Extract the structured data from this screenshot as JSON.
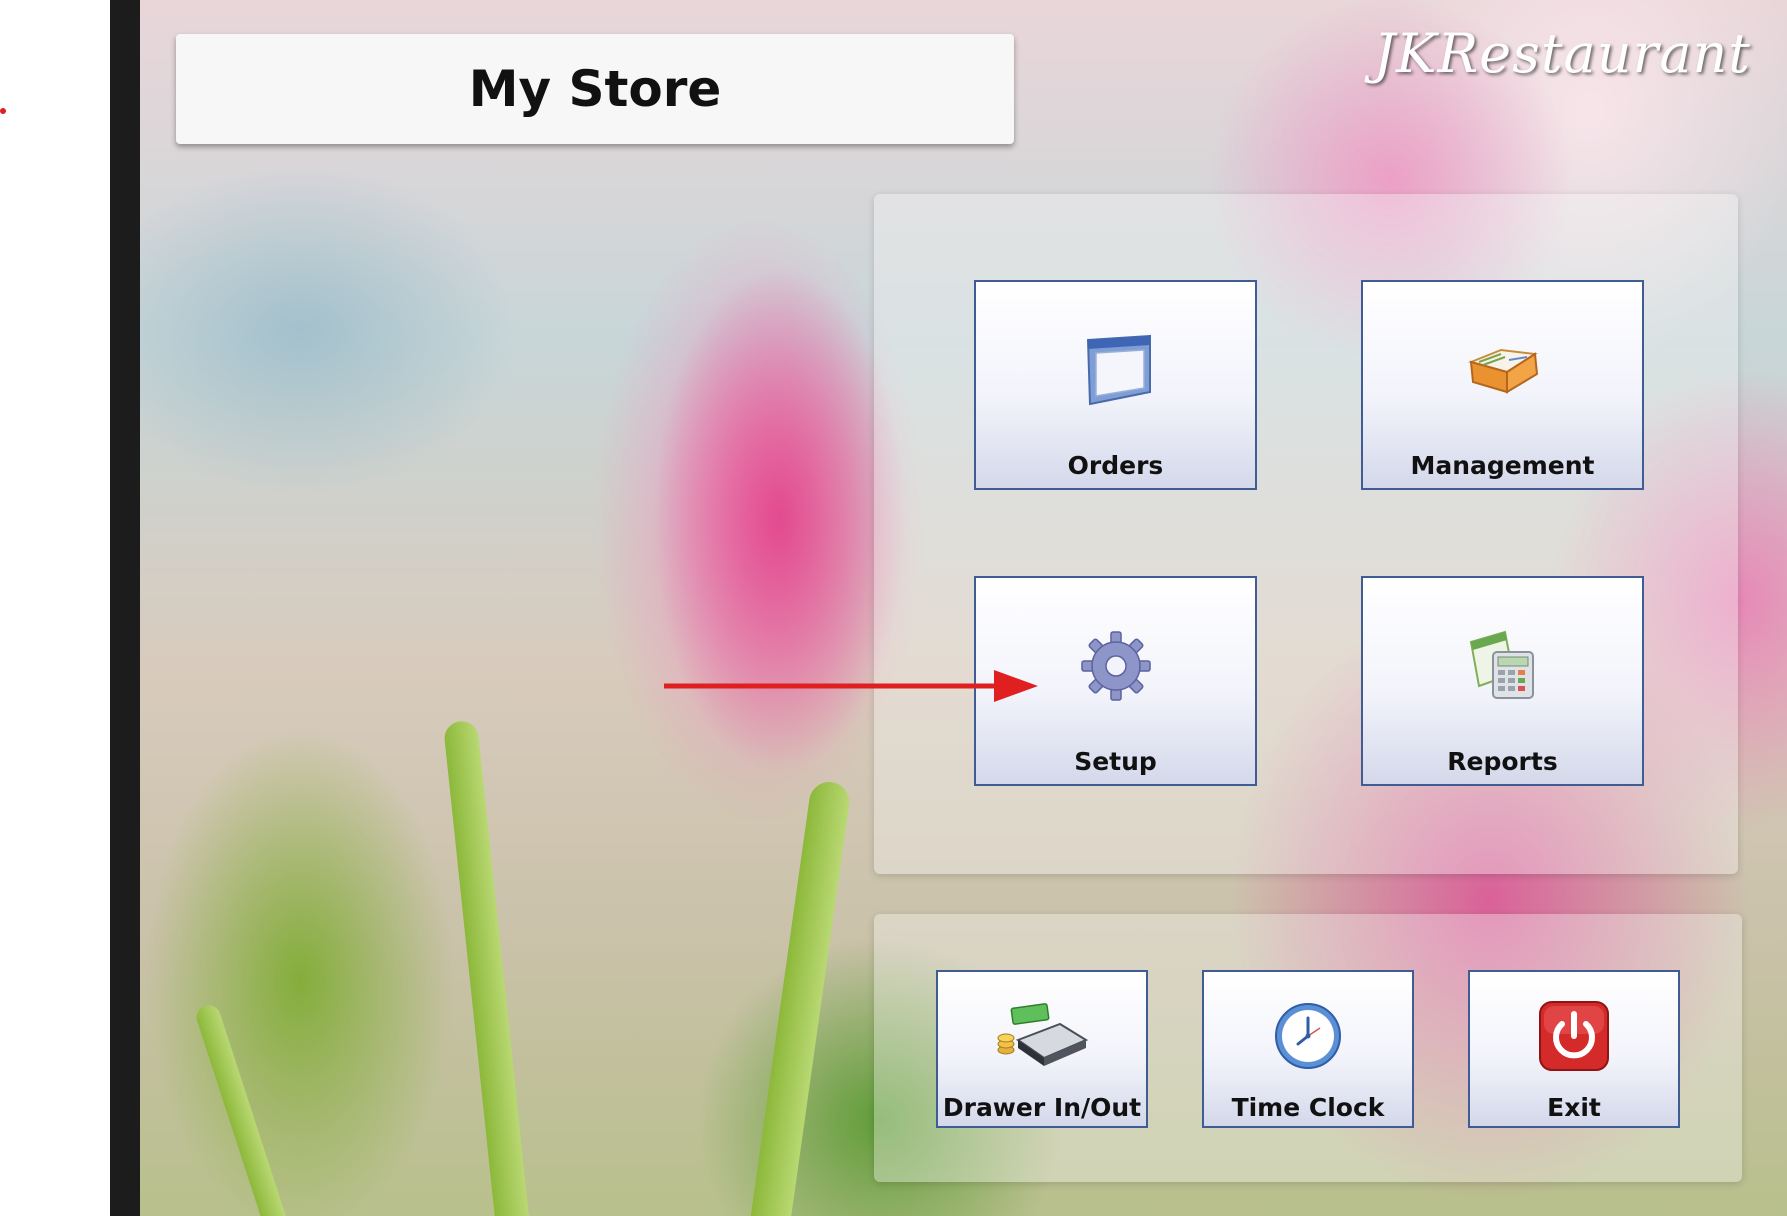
{
  "app": {
    "store_title": "My Store",
    "brand": "JKRestaurant"
  },
  "main_menu": [
    {
      "label": "Orders",
      "icon": "window-icon"
    },
    {
      "label": "Management",
      "icon": "book-icon"
    },
    {
      "label": "Setup",
      "icon": "gear-icon"
    },
    {
      "label": "Reports",
      "icon": "calculator-report-icon"
    }
  ],
  "bottom_menu": [
    {
      "label": "Drawer In/Out",
      "icon": "cash-drawer-icon"
    },
    {
      "label": "Time Clock",
      "icon": "clock-icon"
    },
    {
      "label": "Exit",
      "icon": "power-icon"
    }
  ],
  "colors": {
    "tile_border": "#3f5d94",
    "annotation_arrow": "#e02020",
    "exit_red": "#d42a2a"
  }
}
